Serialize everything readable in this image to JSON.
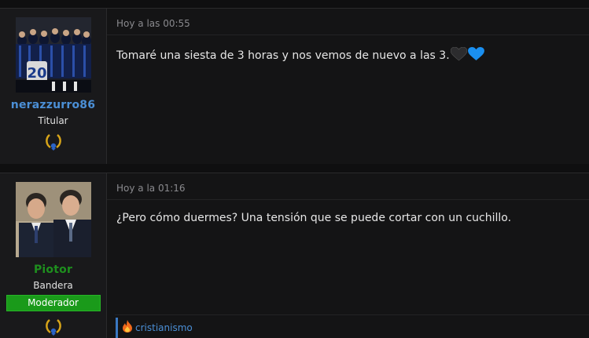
{
  "posts": [
    {
      "username": "nerazzurro86",
      "user_title": "Titular",
      "date": "Hoy a las 00:55",
      "body": "Tomaré una siesta de 3 horas y nos vemos de nuevo a las 3.",
      "emoji": [
        "black-heart-icon",
        "blue-heart-icon"
      ],
      "username_color": "#4b8fd6",
      "avatar_jersey_number": "20"
    },
    {
      "username": "Piotor",
      "user_title": "Bandera",
      "badge": "Moderador",
      "date": "Hoy a la 01:16",
      "body": "¿Pero cómo duermes? Una tensión que se puede cortar con un cuchillo.",
      "reaction_user": "cristianismo",
      "reaction_icon": "fire-icon",
      "username_color": "#1e8f1e",
      "badge_color": "#1a9a1a"
    }
  ]
}
